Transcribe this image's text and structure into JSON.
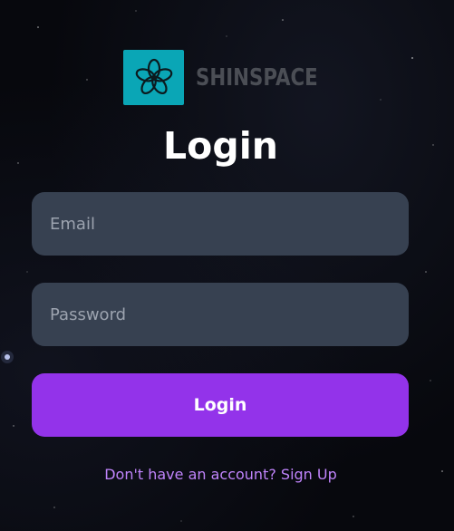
{
  "brand": {
    "name": "SHINSPACE",
    "logo_icon": "flower-icon",
    "logo_color": "#0aa6b6"
  },
  "page": {
    "title": "Login"
  },
  "form": {
    "email_placeholder": "Email",
    "password_placeholder": "Password",
    "submit_label": "Login"
  },
  "footer": {
    "prompt": "Don't have an account?",
    "link_label": "Sign Up"
  },
  "colors": {
    "background": "#07080d",
    "input_bg": "#374151",
    "accent": "#9333ea",
    "link": "#c084fc"
  }
}
